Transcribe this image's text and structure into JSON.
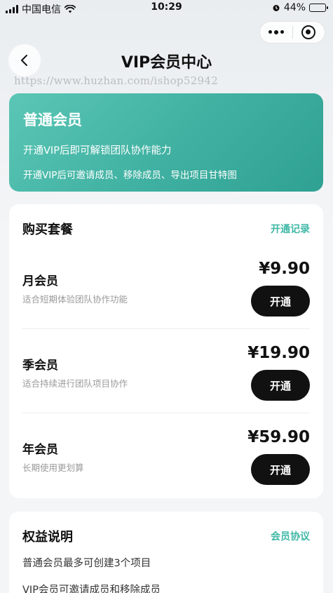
{
  "status_bar": {
    "carrier": "中国电信",
    "time": "10:29",
    "battery": "44%",
    "battery_level": 0.44
  },
  "nav": {
    "title": "VIP会员中心"
  },
  "watermark": "https://www.huzhan.com/ishop52942",
  "member_card": {
    "title": "普通会员",
    "line1": "开通VIP后即可解锁团队协作能力",
    "line2": "开通VIP后可邀请成员、移除成员、导出项目甘特图"
  },
  "plans": {
    "title": "购买套餐",
    "link": "开通记录",
    "items": [
      {
        "name": "月会员",
        "desc": "适合短期体验团队协作功能",
        "price": "¥9.90",
        "button": "开通"
      },
      {
        "name": "季会员",
        "desc": "适合持续进行团队项目协作",
        "price": "¥19.90",
        "button": "开通"
      },
      {
        "name": "年会员",
        "desc": "长期使用更划算",
        "price": "¥59.90",
        "button": "开通"
      }
    ]
  },
  "benefits": {
    "title": "权益说明",
    "link": "会员协议",
    "items": [
      "普通会员最多可创建3个项目",
      "VIP会员可邀请成员和移除成员"
    ]
  },
  "colors": {
    "accent": "#3fb8a6",
    "card_gradient_start": "#5bc6b5",
    "card_gradient_end": "#2fa193",
    "button": "#111111"
  }
}
